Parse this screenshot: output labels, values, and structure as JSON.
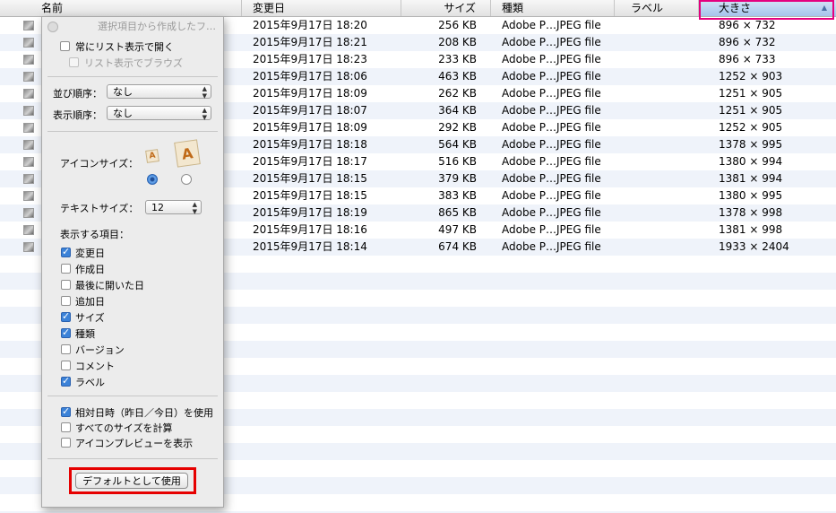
{
  "columns": {
    "name": "名前",
    "date": "変更日",
    "size": "サイズ",
    "kind": "種類",
    "label": "ラベル",
    "dims": "大きさ"
  },
  "sort_indicator": "▲",
  "rows": [
    {
      "date": "2015年9月17日 18:20",
      "size": "256 KB",
      "kind": "Adobe P…JPEG file",
      "dims": "896 × 732"
    },
    {
      "date": "2015年9月17日 18:21",
      "size": "208 KB",
      "kind": "Adobe P…JPEG file",
      "dims": "896 × 732"
    },
    {
      "date": "2015年9月17日 18:23",
      "size": "233 KB",
      "kind": "Adobe P…JPEG file",
      "dims": "896 × 733"
    },
    {
      "date": "2015年9月17日 18:06",
      "size": "463 KB",
      "kind": "Adobe P…JPEG file",
      "dims": "1252 × 903"
    },
    {
      "date": "2015年9月17日 18:09",
      "size": "262 KB",
      "kind": "Adobe P…JPEG file",
      "dims": "1251 × 905"
    },
    {
      "date": "2015年9月17日 18:07",
      "size": "364 KB",
      "kind": "Adobe P…JPEG file",
      "dims": "1251 × 905"
    },
    {
      "date": "2015年9月17日 18:09",
      "size": "292 KB",
      "kind": "Adobe P…JPEG file",
      "dims": "1252 × 905"
    },
    {
      "date": "2015年9月17日 18:18",
      "size": "564 KB",
      "kind": "Adobe P…JPEG file",
      "dims": "1378 × 995"
    },
    {
      "date": "2015年9月17日 18:17",
      "size": "516 KB",
      "kind": "Adobe P…JPEG file",
      "dims": "1380 × 994"
    },
    {
      "date": "2015年9月17日 18:15",
      "size": "379 KB",
      "kind": "Adobe P…JPEG file",
      "dims": "1381 × 994"
    },
    {
      "date": "2015年9月17日 18:15",
      "size": "383 KB",
      "kind": "Adobe P…JPEG file",
      "dims": "1380 × 995"
    },
    {
      "date": "2015年9月17日 18:19",
      "size": "865 KB",
      "kind": "Adobe P…JPEG file",
      "dims": "1378 × 998"
    },
    {
      "date": "2015年9月17日 18:16",
      "size": "497 KB",
      "kind": "Adobe P…JPEG file",
      "dims": "1381 × 998"
    },
    {
      "date": "2015年9月17日 18:14",
      "size": "674 KB",
      "kind": "Adobe P…JPEG file",
      "dims": "1933 × 2404"
    }
  ],
  "panel": {
    "title": "選択項目から作成したフ…",
    "always_list": {
      "label": "常にリスト表示で開く",
      "checked": false
    },
    "browse_list": {
      "label": "リスト表示でブラウズ",
      "checked": false,
      "disabled": true
    },
    "arrange_label": "並び順序：",
    "arrange_value": "なし",
    "sort_label": "表示順序：",
    "sort_value": "なし",
    "icon_size_label": "アイコンサイズ：",
    "icon_size_selected": "small",
    "text_size_label": "テキストサイズ：",
    "text_size_value": "12",
    "show_columns_label": "表示する項目：",
    "columns": [
      {
        "label": "変更日",
        "checked": true
      },
      {
        "label": "作成日",
        "checked": false
      },
      {
        "label": "最後に開いた日",
        "checked": false
      },
      {
        "label": "追加日",
        "checked": false
      },
      {
        "label": "サイズ",
        "checked": true
      },
      {
        "label": "種類",
        "checked": true
      },
      {
        "label": "バージョン",
        "checked": false
      },
      {
        "label": "コメント",
        "checked": false
      },
      {
        "label": "ラベル",
        "checked": true
      }
    ],
    "options": [
      {
        "label": "相対日時（昨日／今日）を使用",
        "checked": true
      },
      {
        "label": "すべてのサイズを計算",
        "checked": false
      },
      {
        "label": "アイコンプレビューを表示",
        "checked": false
      }
    ],
    "default_button": "デフォルトとして使用"
  },
  "colors": {
    "highlight_dims": "#e4007f",
    "highlight_default": "#e60000",
    "accent": "#3b82d8"
  }
}
